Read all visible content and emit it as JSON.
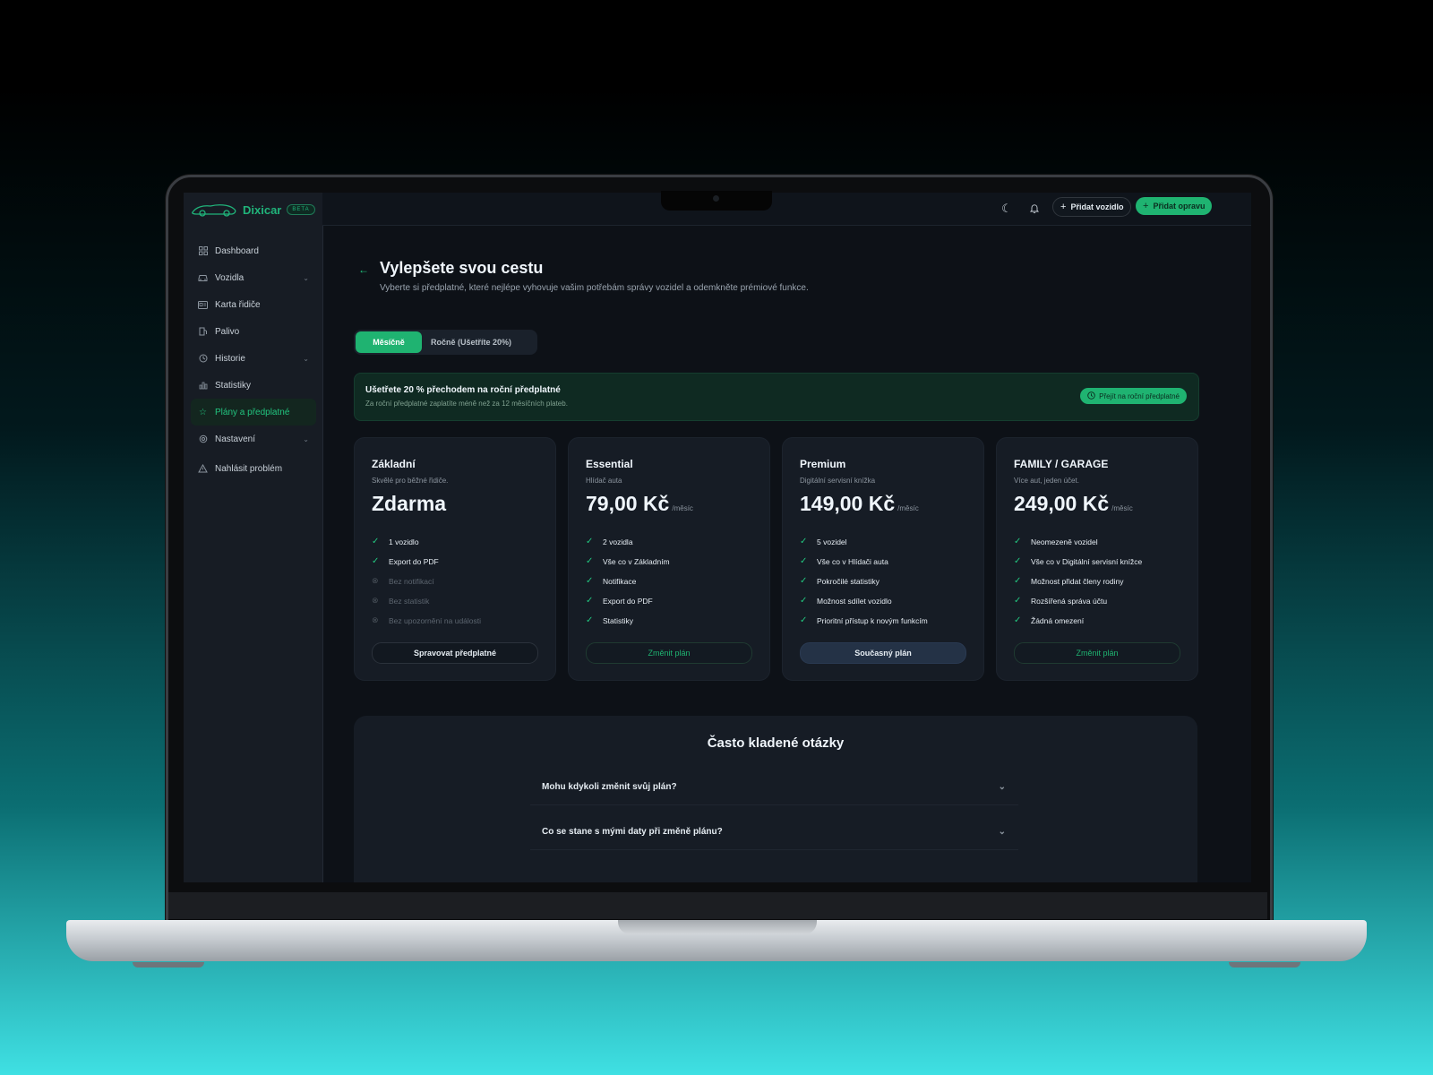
{
  "app": {
    "name": "Dixicar",
    "badge": "BETA"
  },
  "sidebar": {
    "items": [
      {
        "label": "Dashboard",
        "icon": "grid-icon"
      },
      {
        "label": "Vozidla",
        "icon": "car-icon",
        "expandable": true
      },
      {
        "label": "Karta řidiče",
        "icon": "id-card-icon"
      },
      {
        "label": "Palivo",
        "icon": "fuel-icon"
      },
      {
        "label": "Historie",
        "icon": "history-icon",
        "expandable": true
      },
      {
        "label": "Statistiky",
        "icon": "bar-chart-icon"
      },
      {
        "label": "Plány a předplatné",
        "icon": "star-icon",
        "active": true
      },
      {
        "label": "Nastavení",
        "icon": "gear-icon",
        "expandable": true
      },
      {
        "label": "Nahlásit problém",
        "icon": "warning-icon"
      }
    ]
  },
  "topbar": {
    "add_vehicle": "Přidat vozidlo",
    "add_repair": "Přidat opravu"
  },
  "page": {
    "title": "Vylepšete svou cestu",
    "subtitle": "Vyberte si předplatné, které nejlépe vyhovuje vašim potřebám správy vozidel a odemkněte prémiové funkce."
  },
  "billing_toggle": {
    "monthly": "Měsíčně",
    "yearly": "Ročně (Ušetříte 20%)",
    "selected": "monthly"
  },
  "banner": {
    "title": "Ušetřete 20 % přechodem na roční předplatné",
    "subtitle": "Za roční předplatné zaplatíte méně než za 12 měsíčních plateb.",
    "button": "Přejít na roční předplatné"
  },
  "plans": [
    {
      "name": "Základní",
      "desc": "Skvělé pro běžné řidiče.",
      "price": "Zdarma",
      "per": "",
      "features": [
        {
          "text": "1 vozidlo",
          "included": true
        },
        {
          "text": "Export do PDF",
          "included": true
        },
        {
          "text": "Bez notifikací",
          "included": false
        },
        {
          "text": "Bez statistik",
          "included": false
        },
        {
          "text": "Bez upozornění na události",
          "included": false
        }
      ],
      "button": "Spravovat předplatné"
    },
    {
      "name": "Essential",
      "desc": "Hlídač auta",
      "price": "79,00 Kč",
      "per": "/měsíc",
      "features": [
        {
          "text": "2 vozidla",
          "included": true
        },
        {
          "text": "Vše co v Základním",
          "included": true
        },
        {
          "text": "Notifikace",
          "included": true
        },
        {
          "text": "Export do PDF",
          "included": true
        },
        {
          "text": "Statistiky",
          "included": true
        }
      ],
      "button": "Změnit plán"
    },
    {
      "name": "Premium",
      "desc": "Digitální servisní knížka",
      "price": "149,00 Kč",
      "per": "/měsíc",
      "features": [
        {
          "text": "5 vozidel",
          "included": true
        },
        {
          "text": "Vše co v Hlídači auta",
          "included": true
        },
        {
          "text": "Pokročilé statistiky",
          "included": true
        },
        {
          "text": "Možnost sdílet vozidlo",
          "included": true
        },
        {
          "text": "Prioritní přístup k novým funkcím",
          "included": true
        }
      ],
      "button": "Současný plán"
    },
    {
      "name": "FAMILY / GARAGE",
      "desc": "Více aut, jeden účet.",
      "price": "249,00 Kč",
      "per": "/měsíc",
      "features": [
        {
          "text": "Neomezeně vozidel",
          "included": true
        },
        {
          "text": "Vše co v Digitální servisní knížce",
          "included": true
        },
        {
          "text": "Možnost přidat členy rodiny",
          "included": true
        },
        {
          "text": "Rozšířená správa účtu",
          "included": true
        },
        {
          "text": "Žádná omezení",
          "included": true
        }
      ],
      "button": "Změnit plán"
    }
  ],
  "faq": {
    "title": "Často kladené otázky",
    "items": [
      "Mohu kdykoli změnit svůj plán?",
      "Co se stane s mými daty při změně plánu?"
    ]
  },
  "colors": {
    "accent": "#1fb371",
    "background": "#0d1117",
    "sidebar": "#171c24",
    "card": "#161c25"
  }
}
